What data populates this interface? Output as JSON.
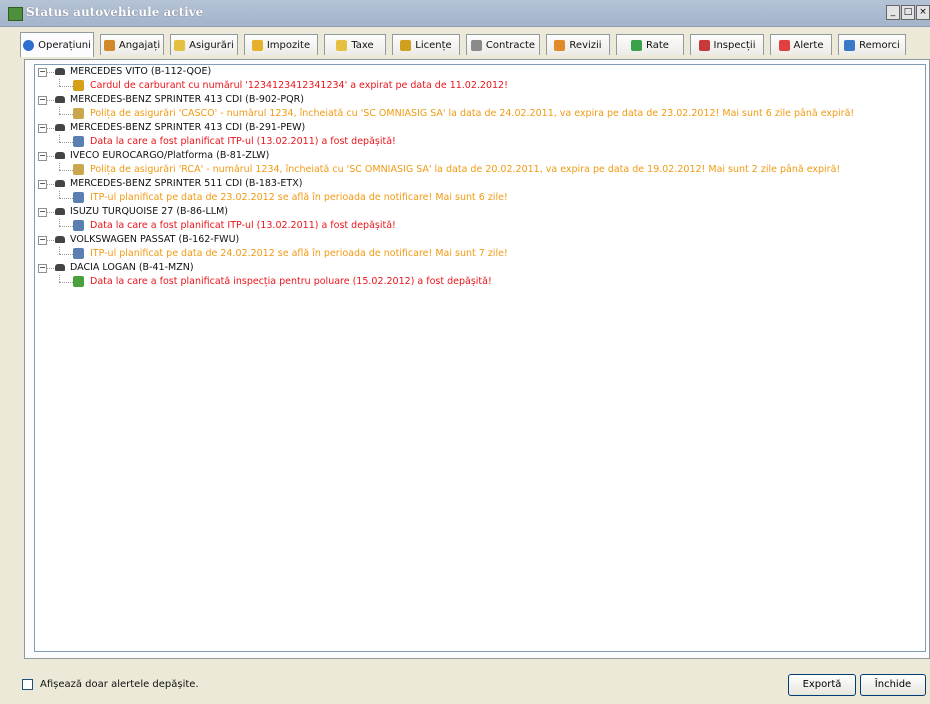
{
  "window": {
    "title": "Status autovehicule active",
    "controls": [
      "_",
      "□",
      "×"
    ]
  },
  "tabs": [
    {
      "label": "Operațiuni",
      "icon": "info-icon",
      "color": "#2f6fd0",
      "active": true
    },
    {
      "label": "Angajați",
      "icon": "people-icon",
      "color": "#d08a2a"
    },
    {
      "label": "Asigurări",
      "icon": "insurance-icon",
      "color": "#e5c040"
    },
    {
      "label": "Impozite",
      "icon": "tax-icon",
      "color": "#e6b02c"
    },
    {
      "label": "Taxe",
      "icon": "fee-icon",
      "color": "#e6c040"
    },
    {
      "label": "Licențe",
      "icon": "license-icon",
      "color": "#d0a020"
    },
    {
      "label": "Contracte",
      "icon": "contract-icon",
      "color": "#8a8a8a"
    },
    {
      "label": "Revizii",
      "icon": "service-icon",
      "color": "#e08a2a"
    },
    {
      "label": "Rate",
      "icon": "rate-icon",
      "color": "#3aa04a"
    },
    {
      "label": "Inspecții",
      "icon": "inspection-icon",
      "color": "#c83a3a"
    },
    {
      "label": "Alerte",
      "icon": "alert-icon",
      "color": "#e04040"
    },
    {
      "label": "Remorci",
      "icon": "trailer-icon",
      "color": "#3a78c8"
    }
  ],
  "vehicles": [
    {
      "name": "MERCEDES VITO (B-112-QOE)",
      "alert": {
        "text": "Cardul de carburant cu numărul '1234123412341234' a expirat pe data de 11.02.2012!",
        "level": "red",
        "icon": "fuel-card-icon"
      }
    },
    {
      "name": "MERCEDES-BENZ SPRINTER 413 CDI (B-902-PQR)",
      "alert": {
        "text": "Polița de asigurări 'CASCO' - numărul 1234, încheiată cu 'SC OMNIASIG SA' la data de 24.02.2011,  va expira pe data de 23.02.2012! Mai sunt 6 zile până expiră!",
        "level": "orange",
        "icon": "insurance-policy-icon"
      }
    },
    {
      "name": "MERCEDES-BENZ SPRINTER 413 CDI (B-291-PEW)",
      "alert": {
        "text": "Data la care a fost planificat ITP-ul (13.02.2011) a fost depășită!",
        "level": "red",
        "icon": "calendar-icon"
      }
    },
    {
      "name": "IVECO EUROCARGO/Platforma (B-81-ZLW)",
      "alert": {
        "text": "Polița de asigurări 'RCA' - numărul 1234, încheiată cu 'SC OMNIASIG SA' la data de 20.02.2011,  va expira pe data de 19.02.2012! Mai sunt 2 zile până expiră!",
        "level": "orange",
        "icon": "insurance-policy-icon"
      }
    },
    {
      "name": "MERCEDES-BENZ SPRINTER 511 CDI (B-183-ETX)",
      "alert": {
        "text": "ITP-ul planificat pe data de 23.02.2012 se află în perioada de notificare! Mai sunt 6 zile!",
        "level": "orange",
        "icon": "calendar-icon"
      }
    },
    {
      "name": "ISUZU TURQUOISE 27 (B-86-LLM)",
      "alert": {
        "text": "Data la care a fost planificat ITP-ul (13.02.2011) a fost depășită!",
        "level": "red",
        "icon": "calendar-icon"
      }
    },
    {
      "name": "VOLKSWAGEN PASSAT (B-162-FWU)",
      "alert": {
        "text": "ITP-ul planificat pe data de 24.02.2012 se află în perioada de notificare! Mai sunt 7 zile!",
        "level": "orange",
        "icon": "calendar-icon"
      }
    },
    {
      "name": "DACIA LOGAN (B-41-MZN)",
      "alert": {
        "text": "Data la care a fost planificată inspecția pentru poluare (15.02.2012) a fost depășită!",
        "level": "red",
        "icon": "pollution-car-icon"
      }
    }
  ],
  "footer": {
    "checkbox_label": "Afișează doar alertele depășite.",
    "checkbox_checked": false,
    "export_label": "Exportă",
    "close_label": "Închide"
  },
  "colors": {
    "alert_red": "#e8151b",
    "alert_orange": "#f09a12"
  }
}
